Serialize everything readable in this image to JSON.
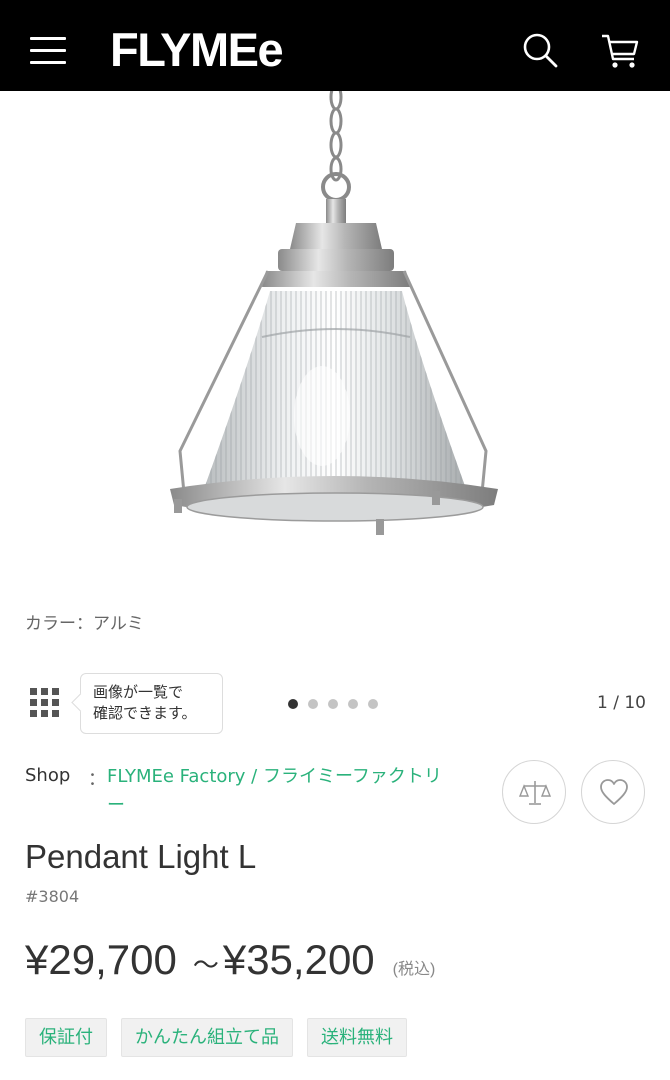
{
  "header": {
    "logo": "FLYMEe",
    "menu_icon": "hamburger-menu-icon",
    "search_icon": "search-icon",
    "cart_icon": "cart-icon"
  },
  "product": {
    "image_subject": "pendant-lamp-image",
    "color_label": "カラー：アルミ",
    "gallery": {
      "tooltip_line1": "画像が一覧で",
      "tooltip_line2": "確認できます。",
      "page_counter": "1 / 10",
      "total_dots": 5,
      "active_dot": 1
    },
    "shop": {
      "label": "Shop",
      "separator": "：",
      "name": "FLYMEe Factory / フライミーファクトリー"
    },
    "name": "Pendant Light L",
    "code": "#3804",
    "price_min": "¥29,700",
    "price_sep": "～",
    "price_max": "¥35,200",
    "tax_note": "(税込)",
    "tags": [
      "保証付",
      "かんたん組立て品",
      "送料無料"
    ]
  },
  "colors": {
    "header_bg": "#000000",
    "accent": "#2ab27b",
    "text": "#333333"
  }
}
